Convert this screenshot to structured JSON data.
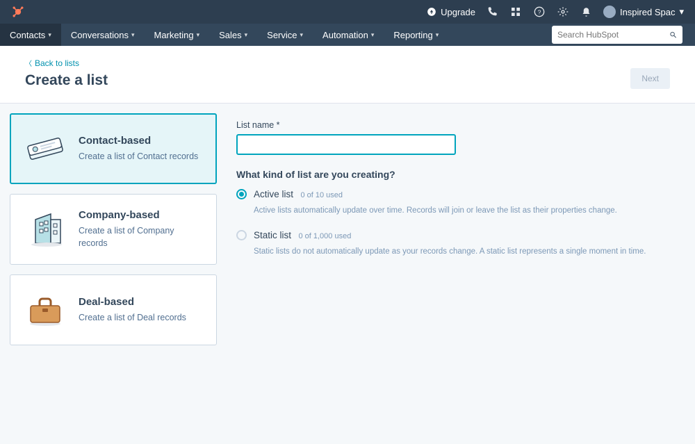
{
  "topbar": {
    "upgrade_label": "Upgrade",
    "account_name": "Inspired Spac"
  },
  "navbar": {
    "items": [
      {
        "label": "Contacts",
        "active": true
      },
      {
        "label": "Conversations"
      },
      {
        "label": "Marketing"
      },
      {
        "label": "Sales"
      },
      {
        "label": "Service"
      },
      {
        "label": "Automation"
      },
      {
        "label": "Reporting"
      }
    ],
    "search_placeholder": "Search HubSpot"
  },
  "page": {
    "back_link": "Back to lists",
    "title": "Create a list",
    "next_button": "Next"
  },
  "list_types": [
    {
      "title": "Contact-based",
      "desc": "Create a list of Contact records",
      "selected": true
    },
    {
      "title": "Company-based",
      "desc": "Create a list of Company records",
      "selected": false
    },
    {
      "title": "Deal-based",
      "desc": "Create a list of Deal records",
      "selected": false
    }
  ],
  "form": {
    "list_name_label": "List name *",
    "list_name_value": "",
    "kind_heading": "What kind of list are you creating?",
    "options": [
      {
        "label": "Active list",
        "usage": "0 of 10 used",
        "desc": "Active lists automatically update over time. Records will join or leave the list as their properties change.",
        "selected": true
      },
      {
        "label": "Static list",
        "usage": "0 of 1,000 used",
        "desc": "Static lists do not automatically update as your records change. A static list represents a single moment in time.",
        "selected": false
      }
    ]
  }
}
